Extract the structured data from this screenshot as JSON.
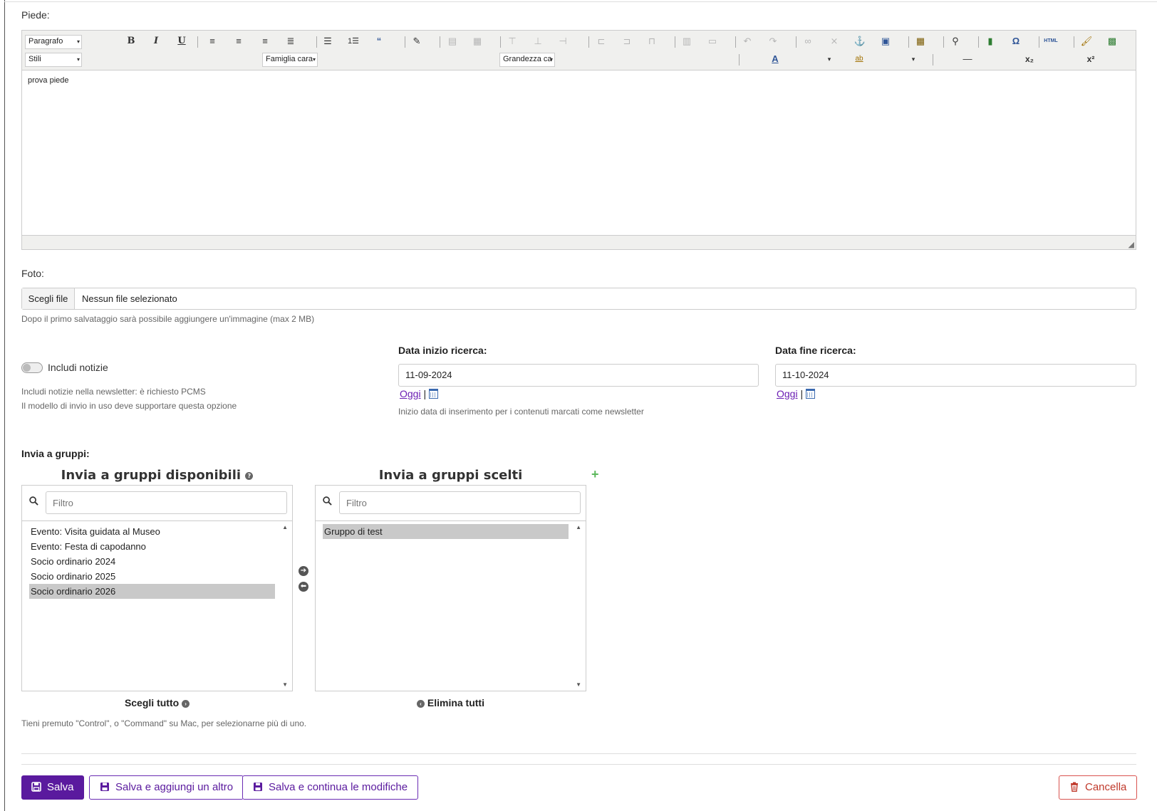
{
  "piede": {
    "label": "Piede:",
    "toolbar": {
      "format_select": "Paragrafo",
      "styles_select": "Stili",
      "font_family_select": "Famiglia cara",
      "font_size_select": "Grandezza ca"
    },
    "content": "prova piede"
  },
  "foto": {
    "label": "Foto:",
    "choose_button": "Scegli file",
    "file_value": "Nessun file selezionato",
    "help": "Dopo il primo salvataggio sarà possibile aggiungere un'immagine (max 2 MB)"
  },
  "includi_notizie": {
    "label": "Includi notizie",
    "enabled": false,
    "help_line1": "Includi notizie nella newsletter: è richiesto PCMS",
    "help_line2": "Il modello di invio in uso deve supportare questa opzione"
  },
  "data_inizio": {
    "label": "Data inizio ricerca:",
    "value": "11-09-2024",
    "today_link": "Oggi",
    "separator": "|",
    "help": "Inizio data di inserimento per i contenuti marcati come newsletter"
  },
  "data_fine": {
    "label": "Data fine ricerca:",
    "value": "11-10-2024",
    "today_link": "Oggi",
    "separator": "|"
  },
  "gruppi": {
    "label": "Invia a gruppi:",
    "available_title": "Invia a gruppi disponibili",
    "chosen_title": "Invia a gruppi scelti",
    "filter_placeholder": "Filtro",
    "available_items": [
      "Evento: Visita guidata al Museo",
      "Evento: Festa di capodanno",
      "Socio ordinario 2024",
      "Socio ordinario 2025",
      "Socio ordinario 2026"
    ],
    "available_selected_index": 4,
    "chosen_items": [
      "Gruppo di test"
    ],
    "chosen_selected_index": 0,
    "choose_all": "Scegli tutto",
    "remove_all": "Elimina tutti",
    "add_symbol": "+",
    "help": "Tieni premuto \"Control\", o \"Command\" su Mac, per selezionarne più di uno."
  },
  "actions": {
    "save": "Salva",
    "save_add": "Salva e aggiungi un altro",
    "save_continue": "Salva e continua le modifiche",
    "delete": "Cancella"
  },
  "colors": {
    "primary": "#5a1a9e",
    "danger": "#c0392b",
    "link": "#6a1cb3",
    "add_green": "#5cb85c"
  }
}
